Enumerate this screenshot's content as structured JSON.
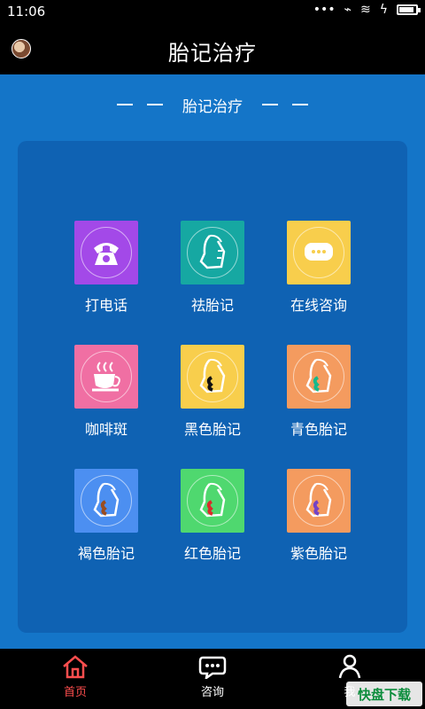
{
  "status_bar": {
    "time": "11:06",
    "icons": [
      "dots-icon",
      "mute-icon",
      "wifi-icon",
      "charging-icon",
      "battery-icon"
    ]
  },
  "header": {
    "title": "胎记治疗",
    "avatar_icon": "avatar-icon"
  },
  "section": {
    "title": "胎记治疗"
  },
  "grid": [
    {
      "label": "打电话",
      "icon": "phone-icon",
      "color": "#a349e8"
    },
    {
      "label": "祛胎记",
      "icon": "face-icon",
      "color": "#16a8a2"
    },
    {
      "label": "在线咨询",
      "icon": "chat-icon",
      "color": "#f8ce4c"
    },
    {
      "label": "咖啡斑",
      "icon": "coffee-icon",
      "color": "#f06fa3"
    },
    {
      "label": "黑色胎记",
      "icon": "face-black-mark-icon",
      "color": "#f8ce4c"
    },
    {
      "label": "青色胎记",
      "icon": "face-cyan-mark-icon",
      "color": "#f49b5f"
    },
    {
      "label": "褐色胎记",
      "icon": "face-brown-mark-icon",
      "color": "#4c8ff1"
    },
    {
      "label": "红色胎记",
      "icon": "face-red-mark-icon",
      "color": "#4fd86f"
    },
    {
      "label": "紫色胎记",
      "icon": "face-purple-mark-icon",
      "color": "#f49b5f"
    }
  ],
  "bottom_nav": [
    {
      "label": "首页",
      "icon": "home-icon",
      "active": true
    },
    {
      "label": "咨询",
      "icon": "chat-bubble-icon",
      "active": false
    },
    {
      "label": "我",
      "icon": "user-icon",
      "active": false
    }
  ],
  "watermark": "快盘下载"
}
